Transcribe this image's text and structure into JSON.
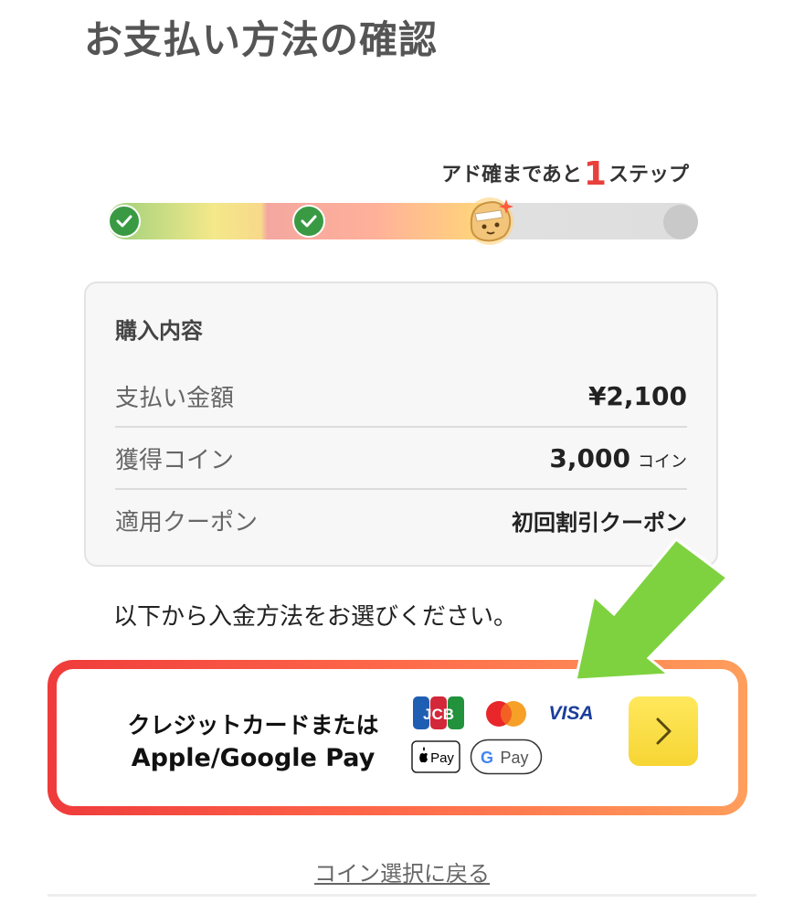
{
  "page": {
    "title": "お支払い方法の確認"
  },
  "progress": {
    "prefix": "アド確まであと",
    "remaining": "1",
    "suffix": "ステップ",
    "completed_steps": 2,
    "total_steps": 4
  },
  "summary": {
    "heading": "購入内容",
    "rows": [
      {
        "label": "支払い金額",
        "value": "¥2,100"
      },
      {
        "label": "獲得コイン",
        "value": "3,000",
        "unit": "コイン"
      },
      {
        "label": "適用クーポン",
        "value": "初回割引クーポン"
      }
    ]
  },
  "instruction": "以下から入金方法をお選びください。",
  "payment": {
    "label_line1": "クレジットカードまたは",
    "label_line2": "Apple/Google Pay",
    "logos": {
      "jcb": "JCB",
      "visa": "VISA",
      "apple_pay": "Pay",
      "google_pay": "Pay"
    },
    "next_icon": "chevron-right-icon"
  },
  "back_link": "コイン選択に戻る",
  "colors": {
    "accent_red": "#e8403c",
    "card_border_start": "#ef3b3b",
    "card_border_end": "#ff9e5c",
    "next_button": "#f6d534",
    "arrow_green": "#7ed23f",
    "check_green": "#3a9a44"
  }
}
